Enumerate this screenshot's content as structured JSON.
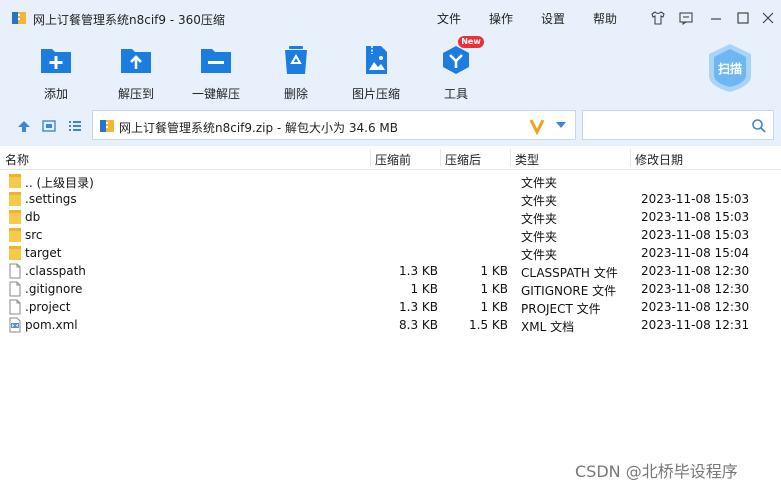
{
  "window": {
    "title": "网上订餐管理系统n8cif9 - 360压缩"
  },
  "menu": [
    {
      "label": "文件"
    },
    {
      "label": "操作"
    },
    {
      "label": "设置"
    },
    {
      "label": "帮助"
    }
  ],
  "toolbar": {
    "items": [
      {
        "label": "添加",
        "icon": "add-icon"
      },
      {
        "label": "解压到",
        "icon": "extract-to-icon"
      },
      {
        "label": "一键解压",
        "icon": "one-click-extract-icon"
      },
      {
        "label": "删除",
        "icon": "recycle-bin-icon"
      },
      {
        "label": "图片压缩",
        "icon": "image-compress-icon"
      },
      {
        "label": "工具",
        "icon": "tools-icon"
      }
    ],
    "new_badge": "New",
    "scan_label": "扫描"
  },
  "address": {
    "path": "网上订餐管理系统n8cif9.zip - 解包大小为 34.6 MB",
    "search_value": ""
  },
  "columns": {
    "name": "名称",
    "size": "压缩前",
    "packed": "压缩后",
    "type": "类型",
    "modified": "修改日期"
  },
  "files": [
    {
      "name": ".. (上级目录)",
      "size": "",
      "packed": "",
      "type": "文件夹",
      "modified": "",
      "icon": "folder-icon"
    },
    {
      "name": ".settings",
      "size": "",
      "packed": "",
      "type": "文件夹",
      "modified": "2023-11-08 15:03",
      "icon": "folder-icon"
    },
    {
      "name": "db",
      "size": "",
      "packed": "",
      "type": "文件夹",
      "modified": "2023-11-08 15:03",
      "icon": "folder-icon"
    },
    {
      "name": "src",
      "size": "",
      "packed": "",
      "type": "文件夹",
      "modified": "2023-11-08 15:03",
      "icon": "folder-icon"
    },
    {
      "name": "target",
      "size": "",
      "packed": "",
      "type": "文件夹",
      "modified": "2023-11-08 15:04",
      "icon": "folder-icon"
    },
    {
      "name": ".classpath",
      "size": "1.3 KB",
      "packed": "1 KB",
      "type": "CLASSPATH 文件",
      "modified": "2023-11-08 12:30",
      "icon": "file-icon"
    },
    {
      "name": ".gitignore",
      "size": "1 KB",
      "packed": "1 KB",
      "type": "GITIGNORE 文件",
      "modified": "2023-11-08 12:30",
      "icon": "file-icon"
    },
    {
      "name": ".project",
      "size": "1.3 KB",
      "packed": "1 KB",
      "type": "PROJECT 文件",
      "modified": "2023-11-08 12:30",
      "icon": "file-icon"
    },
    {
      "name": "pom.xml",
      "size": "8.3 KB",
      "packed": "1.5 KB",
      "type": "XML 文档",
      "modified": "2023-11-08 12:31",
      "icon": "xml-file-icon"
    }
  ],
  "watermark": "CSDN @北桥毕设程序",
  "colors": {
    "accent": "#1c7de0",
    "chrome": "#e8f1fb",
    "folder": "#f7c94b"
  }
}
